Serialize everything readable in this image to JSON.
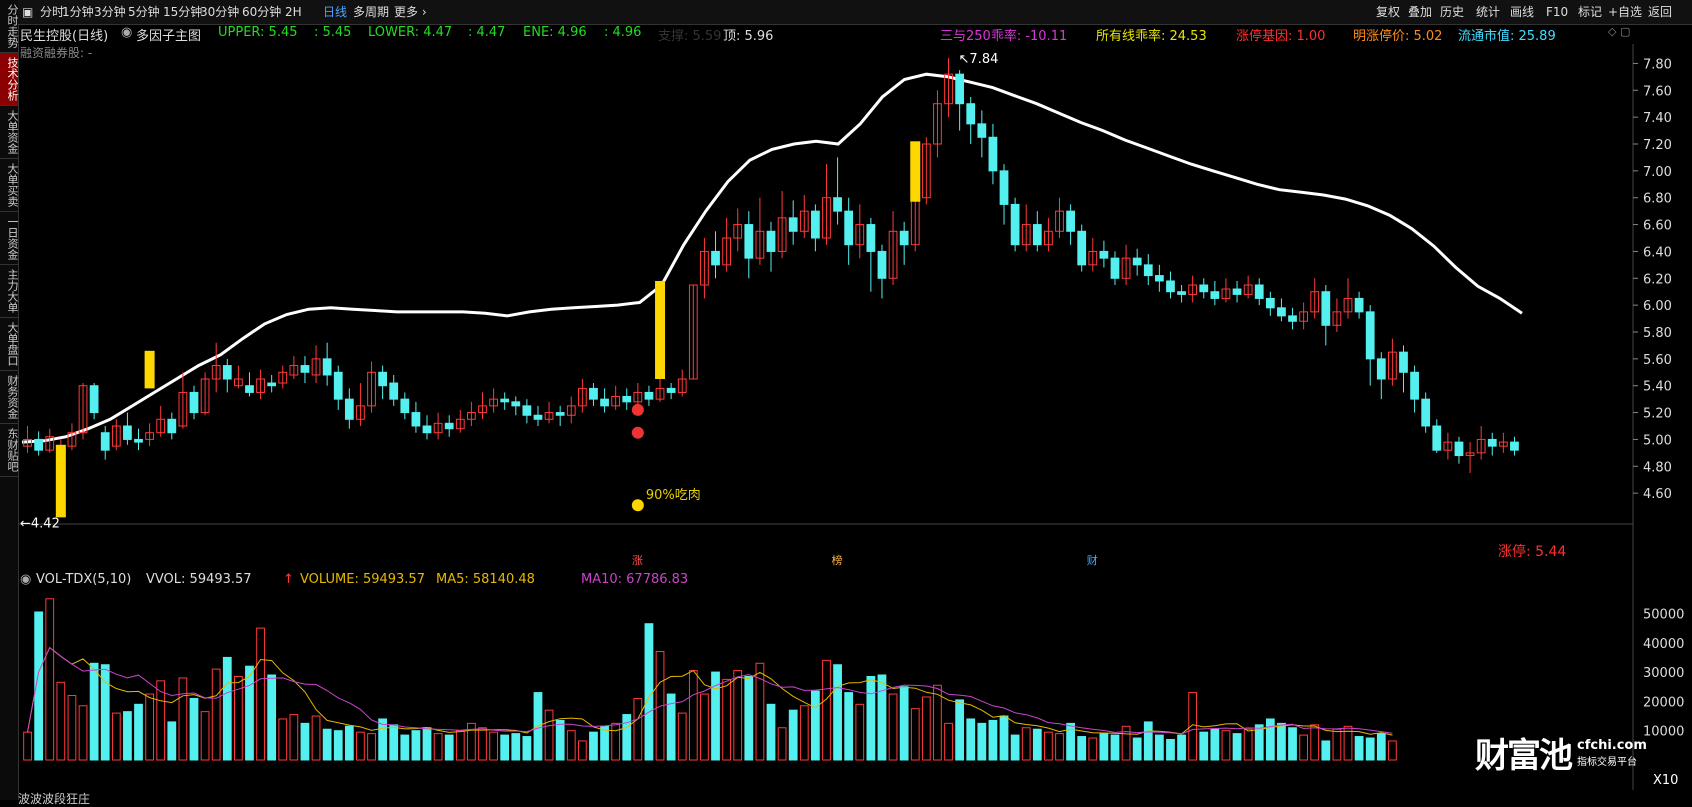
{
  "sidebar": {
    "tabs": [
      {
        "label": "分时走势",
        "active": false
      },
      {
        "label": "技术分析",
        "active": true
      },
      {
        "label": "大单资金",
        "active": false
      },
      {
        "label": "大单买卖",
        "active": false
      },
      {
        "label": "一日资金",
        "active": false
      },
      {
        "label": "主力大单",
        "active": false
      },
      {
        "label": "大单盘口",
        "active": false
      },
      {
        "label": "财务资金",
        "active": false
      },
      {
        "label": "东财贴吧",
        "active": false
      }
    ]
  },
  "toolbar": {
    "periods": [
      "分时",
      "1分钟",
      "3分钟",
      "5分钟",
      "15分钟",
      "30分钟",
      "60分钟",
      "2H",
      "日线",
      "多周期",
      "更多"
    ],
    "active_period": "日线",
    "right": [
      "复权",
      "叠加",
      "历史",
      "统计",
      "画线",
      "F10",
      "标记",
      "+自选",
      "返回"
    ]
  },
  "info": {
    "stock": "民生控股(日线)",
    "factor": "多因子主图",
    "upper": "UPPER: 5.45",
    "upper2": ": 5.45",
    "lower": "LOWER: 4.47",
    "lower2": ": 4.47",
    "ene": "ENE: 4.96",
    "ene2": ": 4.96",
    "zhicheng": "支撑: 5.59",
    "ding": "顶: 5.96",
    "sanyu": "三与250乖率: -10.11",
    "suoyou": "所有线乖率: 24.53",
    "zhangting_jiyin": "涨停基因: 1.00",
    "ming_zhangting": "明涨停价: 5.02",
    "liutong": "流通市值: 25.89",
    "rongzi": "融资融券股: -"
  },
  "annotations": {
    "high_label": "7.84",
    "low_label": "4.42",
    "eat_label": "90%吃肉",
    "limit_up_label": "涨停:  5.44"
  },
  "date_markers": [
    "涨",
    "榜",
    "财"
  ],
  "volume": {
    "title": "VOL-TDX(5,10)",
    "vvol": "VVOL: 59493.57",
    "vol": "VOLUME: 59493.57",
    "ma5": "MA5: 58140.48",
    "ma10": "MA10: 67786.83",
    "scale": "X10"
  },
  "bottom": {
    "label": "波波波段狂庄"
  },
  "watermark": {
    "brand": "财富池",
    "domain": "cfchi.com",
    "sub": "指标交易平台"
  },
  "colors": {
    "up": "#ff3a3a",
    "down": "#54f0f0",
    "bg": "#000000",
    "white_line": "#ffffff",
    "green_line": "#22cc22",
    "red_line": "#ff2020",
    "ma5": "#e6b800",
    "ma10": "#cc44cc",
    "limit_bar": "#ffd700"
  },
  "chart_data": {
    "type": "candlestick",
    "y_ticks": [
      4.6,
      4.8,
      5.0,
      5.2,
      5.4,
      5.6,
      5.8,
      6.0,
      6.2,
      6.4,
      6.6,
      6.8,
      7.0,
      7.2,
      7.4,
      7.6,
      7.8
    ],
    "ylim": [
      4.4,
      7.9
    ],
    "volume_ticks": [
      10000,
      20000,
      30000,
      40000,
      50000
    ],
    "volume_ylim": [
      0,
      58000
    ],
    "candles": [
      [
        4.95,
        5.0,
        5.1,
        4.9
      ],
      [
        5.0,
        4.92,
        5.06,
        4.88
      ],
      [
        4.92,
        5.02,
        5.08,
        4.9
      ],
      [
        4.55,
        4.95,
        5.0,
        4.42
      ],
      [
        4.95,
        5.05,
        5.12,
        4.92
      ],
      [
        5.05,
        5.4,
        5.42,
        5.0
      ],
      [
        5.4,
        5.2,
        5.42,
        5.15
      ],
      [
        5.05,
        4.92,
        5.1,
        4.85
      ],
      [
        4.95,
        5.1,
        5.15,
        4.92
      ],
      [
        5.1,
        5.0,
        5.2,
        4.96
      ],
      [
        5.0,
        4.98,
        5.08,
        4.92
      ],
      [
        5.0,
        5.05,
        5.12,
        4.95
      ],
      [
        5.05,
        5.15,
        5.25,
        5.02
      ],
      [
        5.15,
        5.05,
        5.2,
        5.0
      ],
      [
        5.1,
        5.35,
        5.5,
        5.08
      ],
      [
        5.35,
        5.2,
        5.4,
        5.15
      ],
      [
        5.2,
        5.45,
        5.5,
        5.18
      ],
      [
        5.45,
        5.55,
        5.72,
        5.35
      ],
      [
        5.55,
        5.45,
        5.6,
        5.35
      ],
      [
        5.4,
        5.45,
        5.55,
        5.38
      ],
      [
        5.4,
        5.35,
        5.5,
        5.32
      ],
      [
        5.35,
        5.45,
        5.52,
        5.3
      ],
      [
        5.42,
        5.4,
        5.48,
        5.35
      ],
      [
        5.42,
        5.5,
        5.55,
        5.38
      ],
      [
        5.48,
        5.55,
        5.62,
        5.45
      ],
      [
        5.55,
        5.5,
        5.62,
        5.42
      ],
      [
        5.48,
        5.6,
        5.7,
        5.42
      ],
      [
        5.6,
        5.48,
        5.72,
        5.4
      ],
      [
        5.5,
        5.3,
        5.55,
        5.22
      ],
      [
        5.3,
        5.15,
        5.38,
        5.08
      ],
      [
        5.15,
        5.25,
        5.42,
        5.1
      ],
      [
        5.25,
        5.5,
        5.58,
        5.2
      ],
      [
        5.5,
        5.4,
        5.55,
        5.3
      ],
      [
        5.42,
        5.3,
        5.48,
        5.25
      ],
      [
        5.3,
        5.2,
        5.35,
        5.15
      ],
      [
        5.2,
        5.1,
        5.28,
        5.05
      ],
      [
        5.1,
        5.05,
        5.18,
        5.0
      ],
      [
        5.05,
        5.12,
        5.2,
        5.0
      ],
      [
        5.12,
        5.08,
        5.18,
        5.02
      ],
      [
        5.08,
        5.15,
        5.22,
        5.05
      ],
      [
        5.15,
        5.2,
        5.28,
        5.1
      ],
      [
        5.2,
        5.25,
        5.35,
        5.15
      ],
      [
        5.25,
        5.3,
        5.38,
        5.2
      ],
      [
        5.3,
        5.28,
        5.35,
        5.22
      ],
      [
        5.28,
        5.25,
        5.32,
        5.18
      ],
      [
        5.25,
        5.18,
        5.3,
        5.12
      ],
      [
        5.18,
        5.15,
        5.25,
        5.1
      ],
      [
        5.15,
        5.2,
        5.28,
        5.12
      ],
      [
        5.2,
        5.18,
        5.25,
        5.1
      ],
      [
        5.18,
        5.25,
        5.32,
        5.12
      ],
      [
        5.25,
        5.38,
        5.45,
        5.2
      ],
      [
        5.38,
        5.3,
        5.42,
        5.25
      ],
      [
        5.3,
        5.25,
        5.38,
        5.2
      ],
      [
        5.25,
        5.32,
        5.4,
        5.22
      ],
      [
        5.32,
        5.28,
        5.38,
        5.22
      ],
      [
        5.28,
        5.35,
        5.42,
        5.25
      ],
      [
        5.35,
        5.3,
        5.4,
        5.25
      ],
      [
        5.3,
        5.38,
        5.45,
        5.28
      ],
      [
        5.38,
        5.35,
        5.42,
        5.3
      ],
      [
        5.35,
        5.45,
        5.52,
        5.32
      ],
      [
        5.45,
        6.15,
        6.15,
        5.45
      ],
      [
        6.15,
        6.4,
        6.5,
        6.05
      ],
      [
        6.4,
        6.3,
        6.55,
        6.2
      ],
      [
        6.3,
        6.5,
        6.65,
        6.25
      ],
      [
        6.5,
        6.6,
        6.72,
        6.4
      ],
      [
        6.6,
        6.35,
        6.7,
        6.2
      ],
      [
        6.35,
        6.55,
        6.8,
        6.3
      ],
      [
        6.55,
        6.4,
        6.62,
        6.25
      ],
      [
        6.4,
        6.65,
        6.85,
        6.35
      ],
      [
        6.65,
        6.55,
        6.78,
        6.45
      ],
      [
        6.55,
        6.7,
        6.82,
        6.5
      ],
      [
        6.7,
        6.5,
        6.75,
        6.4
      ],
      [
        6.5,
        6.8,
        7.05,
        6.45
      ],
      [
        6.8,
        6.7,
        7.1,
        6.6
      ],
      [
        6.7,
        6.45,
        6.8,
        6.3
      ],
      [
        6.45,
        6.6,
        6.75,
        6.35
      ],
      [
        6.6,
        6.4,
        6.65,
        6.1
      ],
      [
        6.4,
        6.2,
        6.45,
        6.05
      ],
      [
        6.2,
        6.55,
        6.7,
        6.15
      ],
      [
        6.55,
        6.45,
        6.62,
        6.3
      ],
      [
        6.45,
        6.8,
        7.2,
        6.4
      ],
      [
        6.8,
        7.2,
        7.25,
        6.75
      ],
      [
        7.2,
        7.5,
        7.6,
        7.1
      ],
      [
        7.5,
        7.72,
        7.84,
        7.4
      ],
      [
        7.72,
        7.5,
        7.75,
        7.3
      ],
      [
        7.5,
        7.35,
        7.55,
        7.2
      ],
      [
        7.35,
        7.25,
        7.45,
        7.1
      ],
      [
        7.25,
        7.0,
        7.35,
        6.9
      ],
      [
        7.0,
        6.75,
        7.05,
        6.6
      ],
      [
        6.75,
        6.45,
        6.8,
        6.4
      ],
      [
        6.45,
        6.6,
        6.75,
        6.4
      ],
      [
        6.6,
        6.45,
        6.7,
        6.4
      ],
      [
        6.45,
        6.55,
        6.65,
        6.4
      ],
      [
        6.55,
        6.7,
        6.8,
        6.5
      ],
      [
        6.7,
        6.55,
        6.75,
        6.45
      ],
      [
        6.55,
        6.3,
        6.6,
        6.25
      ],
      [
        6.3,
        6.4,
        6.5,
        6.25
      ],
      [
        6.4,
        6.35,
        6.48,
        6.28
      ],
      [
        6.35,
        6.2,
        6.4,
        6.15
      ],
      [
        6.2,
        6.35,
        6.45,
        6.15
      ],
      [
        6.35,
        6.3,
        6.42,
        6.22
      ],
      [
        6.3,
        6.22,
        6.38,
        6.15
      ],
      [
        6.22,
        6.18,
        6.3,
        6.1
      ],
      [
        6.18,
        6.1,
        6.25,
        6.05
      ],
      [
        6.1,
        6.08,
        6.15,
        6.02
      ],
      [
        6.08,
        6.15,
        6.22,
        6.02
      ],
      [
        6.15,
        6.1,
        6.2,
        6.05
      ],
      [
        6.1,
        6.05,
        6.18,
        6.0
      ],
      [
        6.05,
        6.12,
        6.2,
        6.02
      ],
      [
        6.12,
        6.08,
        6.18,
        6.02
      ],
      [
        6.08,
        6.15,
        6.22,
        6.05
      ],
      [
        6.15,
        6.05,
        6.2,
        6.0
      ],
      [
        6.05,
        5.98,
        6.1,
        5.92
      ],
      [
        5.98,
        5.92,
        6.05,
        5.88
      ],
      [
        5.92,
        5.88,
        5.98,
        5.82
      ],
      [
        5.88,
        5.95,
        6.02,
        5.82
      ],
      [
        5.95,
        6.1,
        6.2,
        5.9
      ],
      [
        6.1,
        5.85,
        6.15,
        5.7
      ],
      [
        5.85,
        5.95,
        6.05,
        5.8
      ],
      [
        5.95,
        6.05,
        6.2,
        5.9
      ],
      [
        6.05,
        5.95,
        6.1,
        5.9
      ],
      [
        5.95,
        5.6,
        6.0,
        5.4
      ],
      [
        5.6,
        5.45,
        5.65,
        5.3
      ],
      [
        5.45,
        5.65,
        5.75,
        5.4
      ],
      [
        5.65,
        5.5,
        5.7,
        5.35
      ],
      [
        5.5,
        5.3,
        5.55,
        5.2
      ],
      [
        5.3,
        5.1,
        5.35,
        5.05
      ],
      [
        5.1,
        4.92,
        5.15,
        4.9
      ],
      [
        4.92,
        4.98,
        5.05,
        4.85
      ],
      [
        4.98,
        4.88,
        5.02,
        4.82
      ],
      [
        4.88,
        4.9,
        4.98,
        4.75
      ],
      [
        4.9,
        5.0,
        5.1,
        4.85
      ],
      [
        5.0,
        4.95,
        5.05,
        4.88
      ],
      [
        4.95,
        4.98,
        5.05,
        4.9
      ],
      [
        4.98,
        4.92,
        5.02,
        4.88
      ]
    ],
    "volumes": [
      9500,
      50500,
      55000,
      26500,
      22000,
      18500,
      33000,
      32500,
      16000,
      16500,
      19000,
      22500,
      27000,
      13000,
      28000,
      21000,
      16500,
      31000,
      35000,
      28500,
      32000,
      45000,
      29000,
      14000,
      15500,
      12500,
      15000,
      10500,
      10000,
      11500,
      9500,
      9000,
      14000,
      12000,
      8500,
      10000,
      11000,
      9000,
      8500,
      10000,
      12500,
      11000,
      9500,
      8500,
      9000,
      8000,
      23000,
      17000,
      13500,
      10000,
      6500,
      9500,
      11500,
      12500,
      15500,
      21000,
      46500,
      37000,
      22500,
      16000,
      30500,
      22500,
      30000,
      27500,
      30500,
      28500,
      33000,
      19000,
      11000,
      17000,
      18500,
      23500,
      34000,
      32500,
      23000,
      19000,
      28500,
      29000,
      22500,
      25000,
      17500,
      21500,
      25500,
      12500,
      20500,
      14000,
      12500,
      13500,
      15000,
      8500,
      11000,
      10500,
      9500,
      9000,
      12500,
      8000,
      7500,
      9000,
      8500,
      11500,
      7500,
      13000,
      8500,
      7000,
      8500,
      23000,
      9500,
      10500,
      10000,
      9000,
      10500,
      12000,
      14000,
      12500,
      11000,
      8500,
      12000,
      6500,
      10500,
      11500,
      8000,
      7500,
      9000,
      6500
    ],
    "upper_line": [
      4.98,
      4.99,
      5.02,
      5.08,
      5.15,
      5.25,
      5.35,
      5.45,
      5.55,
      5.63,
      5.75,
      5.86,
      5.93,
      5.97,
      5.98,
      5.97,
      5.96,
      5.95,
      5.95,
      5.95,
      5.95,
      5.94,
      5.92,
      5.95,
      5.97,
      5.98,
      5.99,
      6.0,
      6.02,
      6.15,
      6.45,
      6.7,
      6.92,
      7.08,
      7.16,
      7.2,
      7.22,
      7.2,
      7.35,
      7.55,
      7.68,
      7.72,
      7.7,
      7.66,
      7.62,
      7.56,
      7.5,
      7.43,
      7.36,
      7.3,
      7.23,
      7.17,
      7.11,
      7.05,
      7.0,
      6.95,
      6.9,
      6.86,
      6.84,
      6.82,
      6.79,
      6.74,
      6.67,
      6.57,
      6.44,
      6.28,
      6.14,
      6.05,
      5.94
    ]
  }
}
